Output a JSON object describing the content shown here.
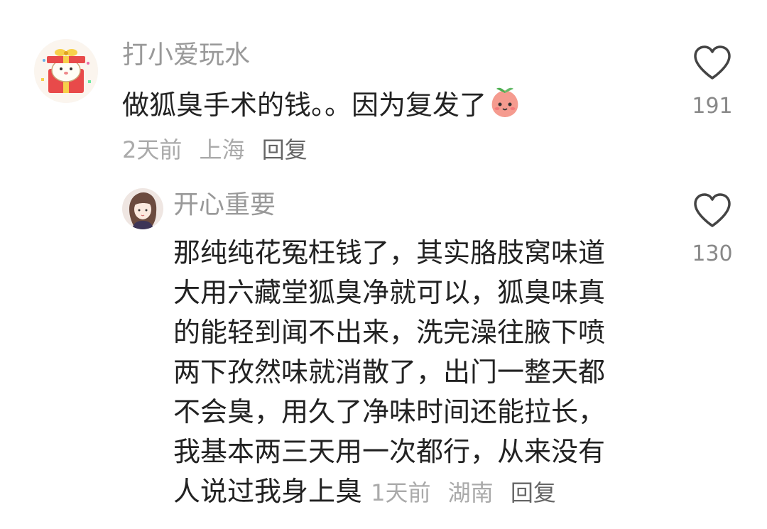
{
  "comments": [
    {
      "username": "打小爱玩水",
      "text": "做狐臭手术的钱。。因为复发了",
      "time": "2天前",
      "location": "上海",
      "reply_label": "回复",
      "likes": "191",
      "emoji_icon": "peach-face-emoji"
    }
  ],
  "replies": [
    {
      "username": "开心重要",
      "lines": [
        "那纯纯花冤枉钱了，其实胳肢窝味道",
        "大用六藏堂狐臭净就可以，狐臭味真",
        "的能轻到闻不出来，洗完澡往腋下喷",
        "两下孜然味就消散了，出门一整天都",
        "不会臭，用久了净味时间还能拉长，",
        "我基本两三天用一次都行，从来没有",
        "人说过我身上臭"
      ],
      "time": "1天前",
      "location": "湖南",
      "reply_label": "回复",
      "likes": "130"
    }
  ],
  "colors": {
    "username": "#999999",
    "text": "#222222",
    "meta": "#aaaaaa",
    "reply": "#666666",
    "heart_stroke": "#444444"
  }
}
